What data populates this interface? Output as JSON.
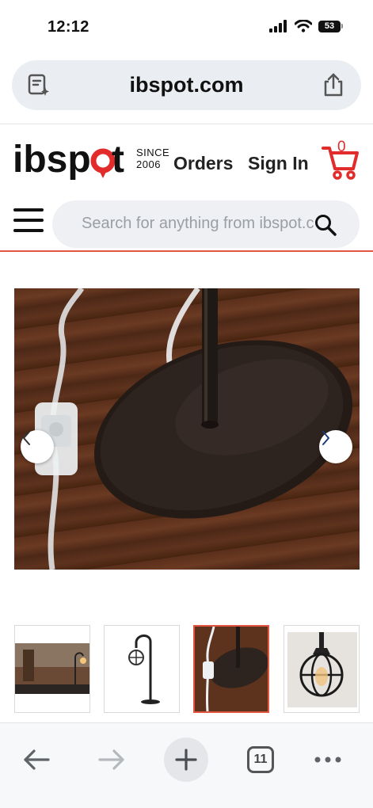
{
  "status_bar": {
    "time": "12:12",
    "battery": "53"
  },
  "browser": {
    "url": "ibspot.com",
    "open_tabs": "11"
  },
  "site": {
    "logo_text": "ibspot",
    "since_line1": "SINCE",
    "since_line2": "2006",
    "orders_label": "Orders",
    "signin_label": "Sign In",
    "cart_count": "0",
    "search_placeholder": "Search for anything from ibspot.c"
  },
  "gallery": {
    "thumbnail_count": 4,
    "active_thumbnail": 3
  },
  "colors": {
    "accent": "#e2553e",
    "cart_red": "#e22b2b",
    "url_bar_bg": "#eaedf1"
  },
  "icons": {
    "url_left": "page-sparkle-icon",
    "share": "share-icon",
    "cart": "cart-icon",
    "menu": "hamburger-menu-icon",
    "search": "search-icon",
    "prev": "chevron-left-icon",
    "next": "chevron-right-icon",
    "back": "back-arrow-icon",
    "forward": "forward-arrow-icon",
    "new_tab": "plus-icon",
    "more": "more-dots-icon"
  }
}
